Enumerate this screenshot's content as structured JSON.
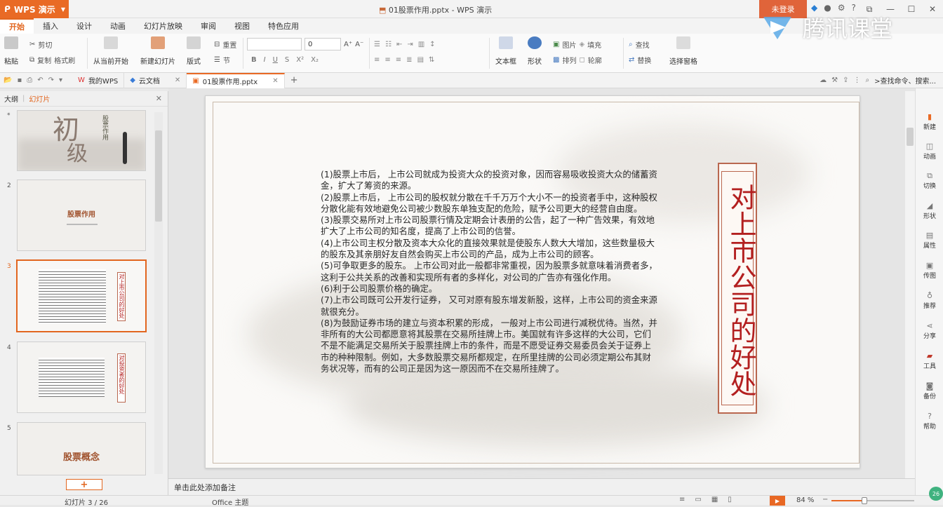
{
  "app": {
    "name": "WPS 演示",
    "window_title": "01股票作用.pptx - WPS 演示",
    "login_label": "未登录",
    "watermark_text": "腾讯课堂"
  },
  "ribbon_tabs": [
    "开始",
    "插入",
    "设计",
    "动画",
    "幻灯片放映",
    "审阅",
    "视图",
    "特色应用"
  ],
  "ribbon": {
    "paste": "粘贴",
    "cut": "剪切",
    "copy": "复制",
    "format_painter": "格式刷",
    "from_current": "从当前开始",
    "new_slide": "新建幻灯片",
    "layout": "版式",
    "reset": "重置",
    "section": "节",
    "font_size": "0",
    "textbox": "文本框",
    "shape": "形状",
    "picture": "图片",
    "arrange": "排列",
    "fill": "填充",
    "outline": "轮廓",
    "find": "查找",
    "replace": "替换",
    "select_pane": "选择窗格"
  },
  "doc_tabs": [
    {
      "label": "我的WPS"
    },
    {
      "label": "云文档"
    },
    {
      "label": "01股票作用.pptx",
      "active": true
    }
  ],
  "search_placeholder": ">查找命令、搜索...",
  "left_panel": {
    "tab_outline": "大纲",
    "tab_slides": "幻灯片",
    "thumbs": [
      {
        "num": "1",
        "big": "初",
        "big2": "级",
        "side": "股票作用"
      },
      {
        "num": "2",
        "title": "股票作用"
      },
      {
        "num": "3",
        "vtitle": "对上市公司的好处"
      },
      {
        "num": "4",
        "vtitle": "对投资者的好处"
      },
      {
        "num": "5",
        "title": "股票概念"
      }
    ],
    "add_label": "+"
  },
  "slide": {
    "paragraphs": [
      "(1)股票上市后， 上市公司就成为投资大众的投资对象，因而容易吸收投资大众的储蓄资金，扩大了筹资的来源。",
      "(2)股票上市后， 上市公司的股权就分散在千千万万个大小不一的投资者手中，这种股权分散化能有效地避免公司被少数股东单独支配的危险，赋予公司更大的经营自由度。",
      "(3)股票交易所对上市公司股票行情及定期会计表册的公告，起了一种广告效果，有效地扩大了上市公司的知名度，提高了上市公司的信誉。",
      "(4)上市公司主权分散及资本大众化的直接效果就是使股东人数大大增加，这些数量极大的股东及其亲朋好友自然会购买上市公司的产品，成为上市公司的顾客。",
      "(5)可争取更多的股东。 上市公司对此一般都非常重视，因为股票多就意味着消费者多，这利于公共关系的改善和实现所有者的多样化，对公司的广告亦有强化作用。",
      "(6)利于公司股票价格的确定。",
      "(7)上市公司既可公开发行证券， 又可对原有股东增发新股，这样，上市公司的资金来源就很充分。",
      "(8)为鼓励证券市场的建立与资本积累的形成， 一般对上市公司进行减税优待。当然，并非所有的大公司都愿意将其股票在交易所挂牌上市。美国就有许多这样的大公司，它们不是不能满足交易所关于股票挂牌上市的条件，而是不愿受证券交易委员会关于证券上市的种种限制。例如，大多数股票交易所都规定，在所里挂牌的公司必须定期公布其财务状况等，而有的公司正是因为这一原因而不在交易所挂牌了。"
    ],
    "vertical_title": "对上市公司的好处",
    "title_color": "#b31f1f"
  },
  "notes_placeholder": "单击此处添加备注",
  "right_sidebar": [
    "新建",
    "动画",
    "切换",
    "形状",
    "属性",
    "传图",
    "推荐",
    "分享",
    "工具",
    "备份",
    "帮助"
  ],
  "status": {
    "slide_indicator": "幻灯片 3 / 26",
    "theme": "Office 主题",
    "zoom": "84 %",
    "zoom_value": 0.4,
    "badge": "26"
  },
  "colors": {
    "accent": "#e96a25"
  }
}
